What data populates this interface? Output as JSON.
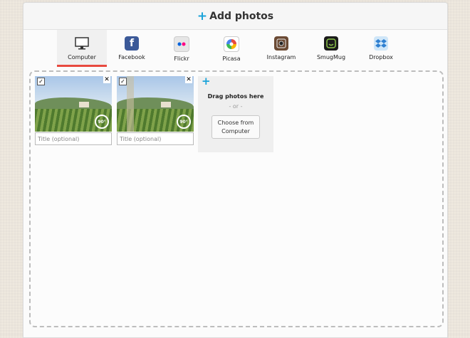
{
  "header": {
    "title": "Add photos"
  },
  "sources": [
    {
      "label": "Computer",
      "icon": "computer-icon"
    },
    {
      "label": "Facebook",
      "icon": "facebook-icon"
    },
    {
      "label": "Flickr",
      "icon": "flickr-icon"
    },
    {
      "label": "Picasa",
      "icon": "picasa-icon"
    },
    {
      "label": "Instagram",
      "icon": "instagram-icon"
    },
    {
      "label": "SmugMug",
      "icon": "smugmug-icon"
    },
    {
      "label": "Dropbox",
      "icon": "dropbox-icon"
    }
  ],
  "active_source": "Computer",
  "photos": [
    {
      "title_placeholder": "Title (optional)",
      "rotate_label": "90°"
    },
    {
      "title_placeholder": "Title (optional)",
      "rotate_label": "90°"
    }
  ],
  "upload": {
    "drag_text": "Drag photos here",
    "or_text": "- or -",
    "choose_button": "Choose from Computer"
  },
  "colors": {
    "accent": "#1aa3d9",
    "active_tab": "#e84a3f"
  }
}
